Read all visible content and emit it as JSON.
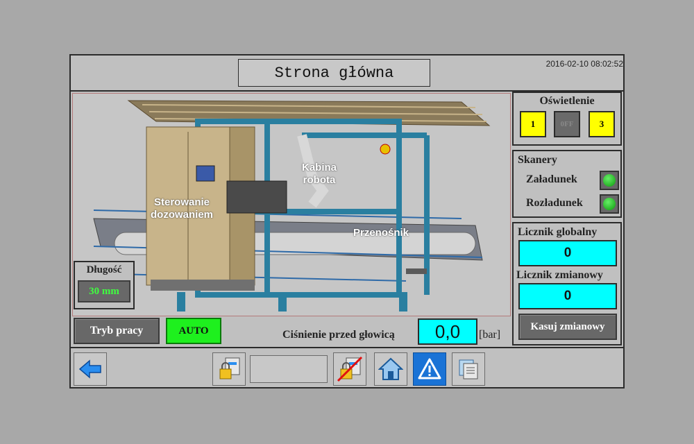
{
  "header": {
    "title": "Strona główna",
    "datetime": "2016-02-10 08:02:52"
  },
  "scene": {
    "labels": {
      "robot_cabin": "Kabina\nrobota",
      "dosing_control": "Sterowanie\ndozowaniem",
      "conveyor": "Przenośnik"
    }
  },
  "length": {
    "title": "Długość",
    "value": "30 mm"
  },
  "mode": {
    "button_label": "Tryb pracy",
    "value": "AUTO"
  },
  "pressure": {
    "label": "Ciśnienie przed głowicą",
    "value": "0,0",
    "unit": "[bar]"
  },
  "lighting": {
    "title": "Oświetlenie",
    "buttons": [
      {
        "label": "1",
        "state": "on"
      },
      {
        "label": "0FF",
        "state": "off"
      },
      {
        "label": "3",
        "state": "on"
      }
    ]
  },
  "scanners": {
    "title": "Skanery",
    "items": [
      {
        "label": "Załadunek",
        "status": "ok"
      },
      {
        "label": "Rozładunek",
        "status": "ok"
      }
    ]
  },
  "counters": {
    "global_label": "Licznik globalny",
    "global_value": "0",
    "shift_label": "Licznik zmianowy",
    "shift_value": "0",
    "reset_label": "Kasuj zmianowy"
  },
  "nav": {
    "icons": [
      "back-arrow-icon",
      "login-lock-icon",
      "logout-lock-icon",
      "home-icon",
      "alarm-warning-icon",
      "pages-icon"
    ]
  },
  "colors": {
    "accent_cyan": "#00ffff",
    "auto_green": "#1ef01e",
    "lamp_yellow": "#ffff00",
    "nav_active": "#1a73d6"
  }
}
